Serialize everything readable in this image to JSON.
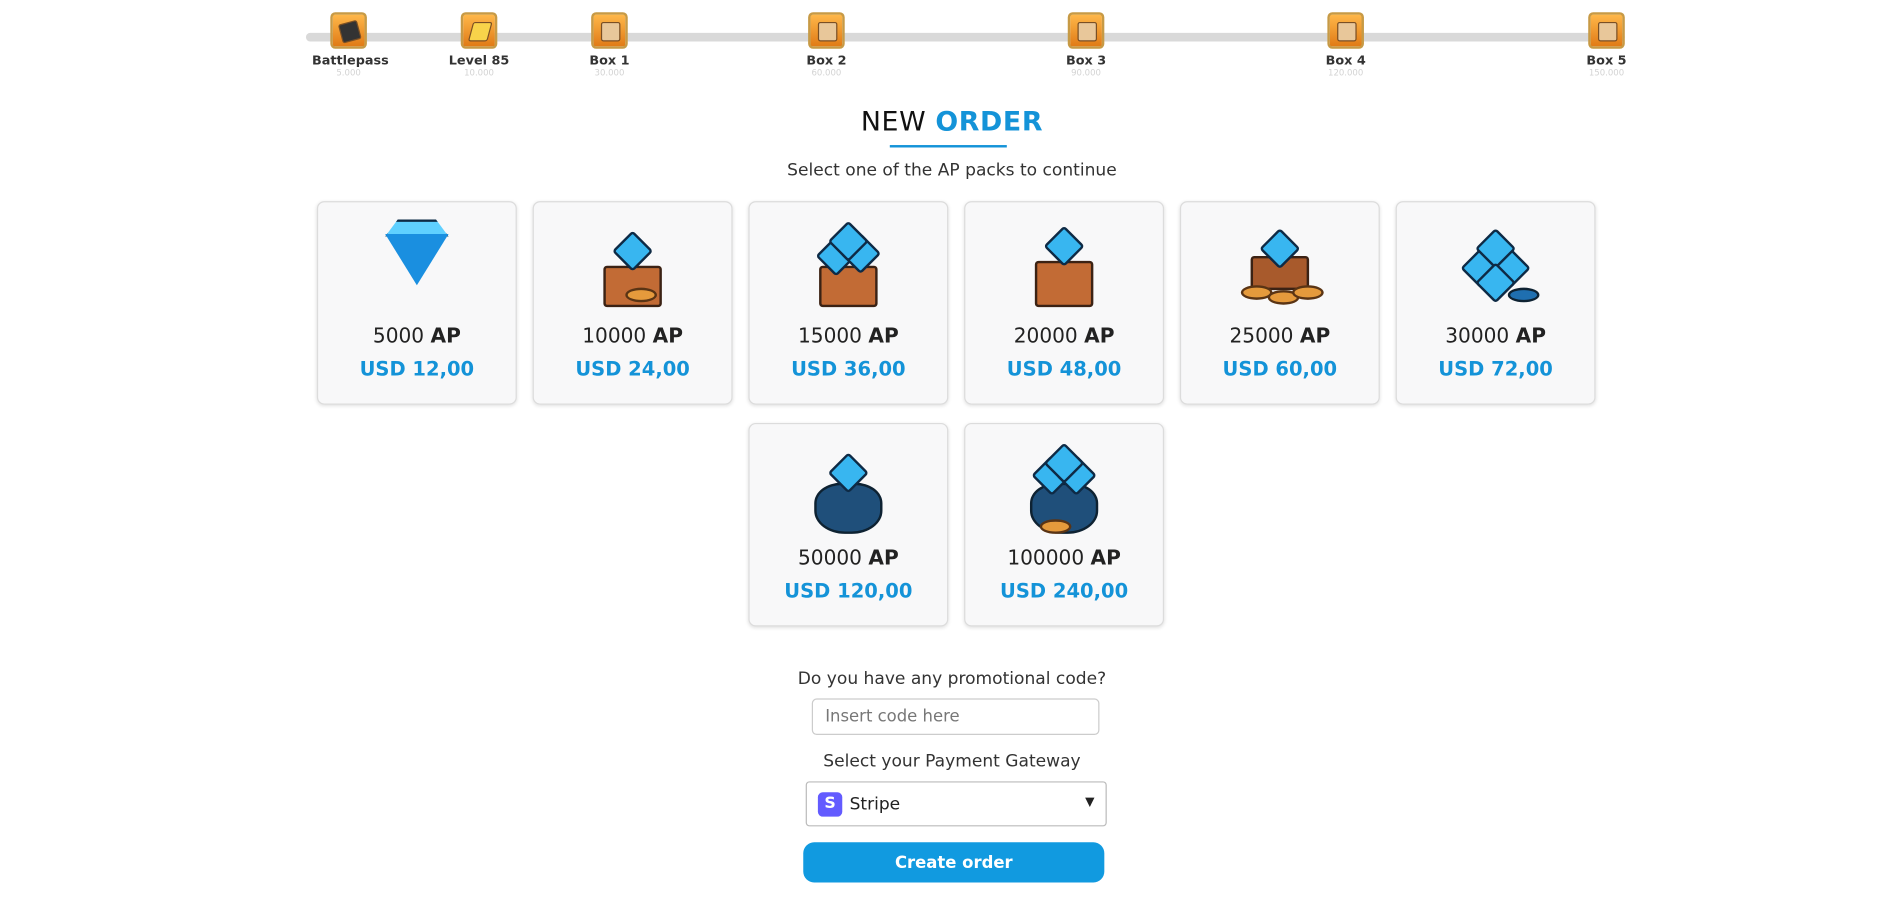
{
  "progress": {
    "milestones": [
      {
        "label": "Battlepass",
        "sub": "5.000",
        "icon": "battlepass-icon"
      },
      {
        "label": "Level 85",
        "sub": "10.000",
        "icon": "level-icon"
      },
      {
        "label": "Box 1",
        "sub": "30.000",
        "icon": "chest-icon"
      },
      {
        "label": "Box 2",
        "sub": "60.000",
        "icon": "chest-icon"
      },
      {
        "label": "Box 3",
        "sub": "90.000",
        "icon": "chest-icon"
      },
      {
        "label": "Box 4",
        "sub": "120.000",
        "icon": "chest-icon"
      },
      {
        "label": "Box 5",
        "sub": "150.000",
        "icon": "chest-icon"
      }
    ]
  },
  "header": {
    "title_plain": "NEW",
    "title_accent": "ORDER",
    "subtitle": "Select one of the AP packs to continue"
  },
  "packs": [
    {
      "amount": "5000",
      "unit": "AP",
      "price": "USD 12,00",
      "icon": "diamond-icon"
    },
    {
      "amount": "10000",
      "unit": "AP",
      "price": "USD 24,00",
      "icon": "gem-crate-icon"
    },
    {
      "amount": "15000",
      "unit": "AP",
      "price": "USD 36,00",
      "icon": "gem-crate-icon"
    },
    {
      "amount": "20000",
      "unit": "AP",
      "price": "USD 48,00",
      "icon": "gem-chest-icon"
    },
    {
      "amount": "25000",
      "unit": "AP",
      "price": "USD 60,00",
      "icon": "gem-coins-icon"
    },
    {
      "amount": "30000",
      "unit": "AP",
      "price": "USD 72,00",
      "icon": "gem-pile-icon"
    },
    {
      "amount": "50000",
      "unit": "AP",
      "price": "USD 120,00",
      "icon": "gem-bag-icon"
    },
    {
      "amount": "100000",
      "unit": "AP",
      "price": "USD 240,00",
      "icon": "gem-bag-coins-icon"
    }
  ],
  "promo": {
    "label": "Do you have any promotional code?",
    "placeholder": "Insert code here",
    "value": ""
  },
  "gateway": {
    "label": "Select your Payment Gateway",
    "selected": "Stripe",
    "logo_letter": "S",
    "logo_color": "#635bff"
  },
  "actions": {
    "create_order": "Create order"
  },
  "colors": {
    "accent": "#1493d8",
    "button": "#119ae0"
  }
}
